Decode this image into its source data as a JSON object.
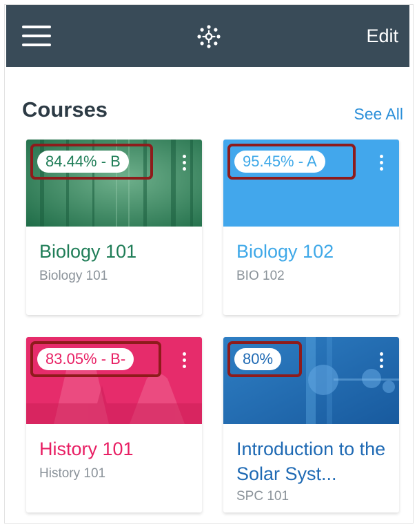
{
  "navbar": {
    "menu_icon": "hamburger-menu-icon",
    "logo_icon": "canvas-logo-icon",
    "edit_label": "Edit",
    "bg_color": "#394b58"
  },
  "dashboard": {
    "title": "Courses",
    "see_all_label": "See All"
  },
  "courses": [
    {
      "grade": "84.44% - B",
      "name": "Biology 101",
      "code": "Biology 101",
      "color": "#1f7d57",
      "image": "forest"
    },
    {
      "grade": "95.45% - A",
      "name": "Biology 102",
      "code": "BIO 102",
      "color": "#3ea8e8",
      "image": "solid-blue"
    },
    {
      "grade": "83.05% - B-",
      "name": "History 101",
      "code": "History 101",
      "color": "#e81e63",
      "image": "statue"
    },
    {
      "grade": "80%",
      "name": "Introduction to the Solar Syst...",
      "code": "SPC 101",
      "color": "#1f6ab4",
      "image": "planets"
    }
  ],
  "highlight_color": "#8e1b1b"
}
